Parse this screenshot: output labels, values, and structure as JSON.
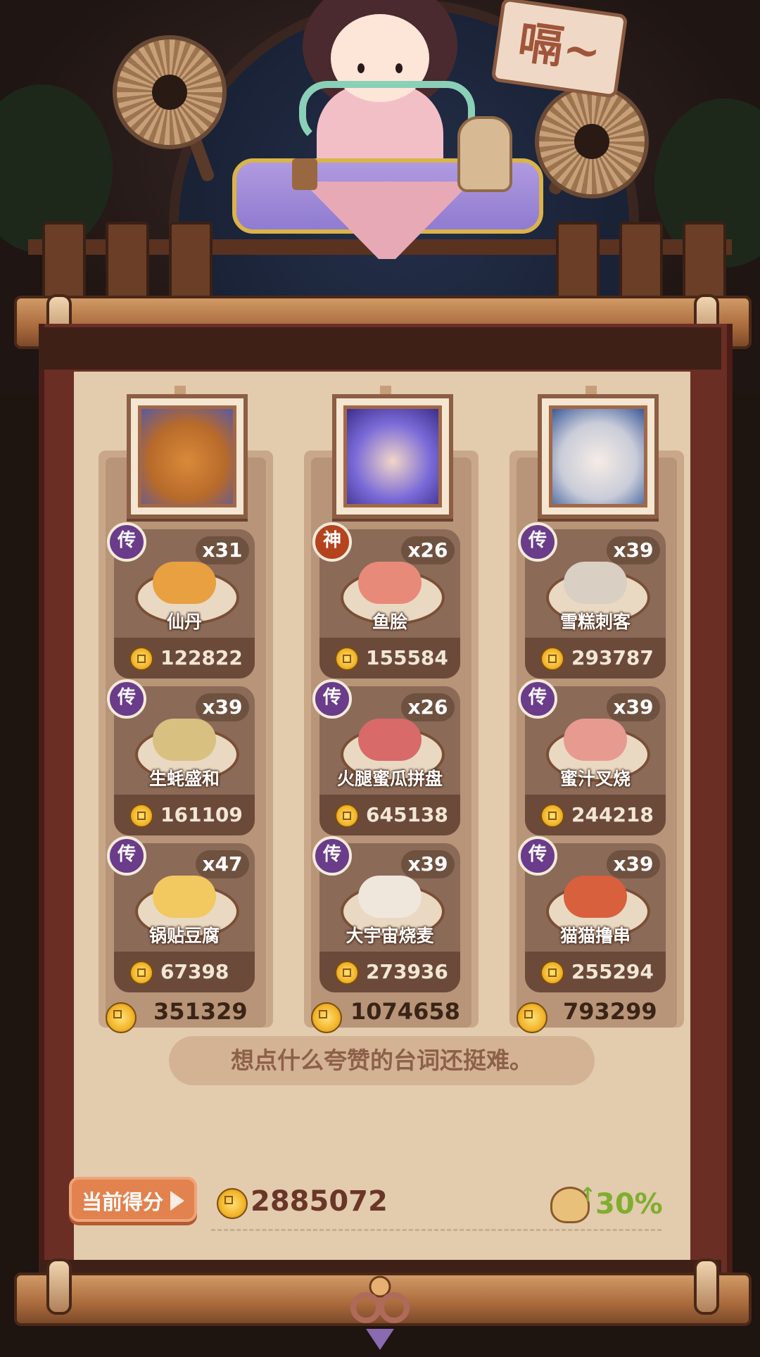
{
  "header": {
    "sign_text": "嗝~"
  },
  "columns": [
    {
      "portrait": "bear-chef-portrait",
      "total": "351329",
      "dishes": [
        {
          "badge": "传",
          "rarity": "legendary",
          "qty": "x31",
          "name": "仙丹",
          "price": "122822",
          "food_color": "#e8a040"
        },
        {
          "badge": "传",
          "rarity": "legendary",
          "qty": "x39",
          "name": "生蚝盛和",
          "price": "161109",
          "food_color": "#d8c080"
        },
        {
          "badge": "传",
          "rarity": "legendary",
          "qty": "x47",
          "name": "锅贴豆腐",
          "price": "67398",
          "food_color": "#f2c860"
        }
      ]
    },
    {
      "portrait": "blue-hair-girl-portrait",
      "total": "1074658",
      "dishes": [
        {
          "badge": "神",
          "rarity": "divine",
          "qty": "x26",
          "name": "鱼脍",
          "price": "155584",
          "food_color": "#e88a7a"
        },
        {
          "badge": "传",
          "rarity": "legendary",
          "qty": "x26",
          "name": "火腿蜜瓜拼盘",
          "price": "645138",
          "food_color": "#d86a6a"
        },
        {
          "badge": "传",
          "rarity": "legendary",
          "qty": "x39",
          "name": "大宇宙烧麦",
          "price": "273936",
          "food_color": "#efe6dc"
        }
      ]
    },
    {
      "portrait": "silver-hair-boy-portrait",
      "total": "793299",
      "dishes": [
        {
          "badge": "传",
          "rarity": "legendary",
          "qty": "x39",
          "name": "雪糕刺客",
          "price": "293787",
          "food_color": "#d9cfc2"
        },
        {
          "badge": "传",
          "rarity": "legendary",
          "qty": "x39",
          "name": "蜜汁叉烧",
          "price": "244218",
          "food_color": "#e79a90"
        },
        {
          "badge": "传",
          "rarity": "legendary",
          "qty": "x39",
          "name": "猫猫撸串",
          "price": "255294",
          "food_color": "#d8603c"
        }
      ]
    }
  ],
  "quote": "想点什么夸赞的台词还挺难。",
  "score": {
    "label": "当前得分",
    "value": "2885072",
    "bonus": "30%"
  },
  "colors": {
    "paper": "#e3cbae",
    "accent_orange": "#e2824e",
    "bonus_green": "#7fae2e",
    "legend_purple": "#6a3c8a",
    "divine_red": "#b4431e"
  }
}
